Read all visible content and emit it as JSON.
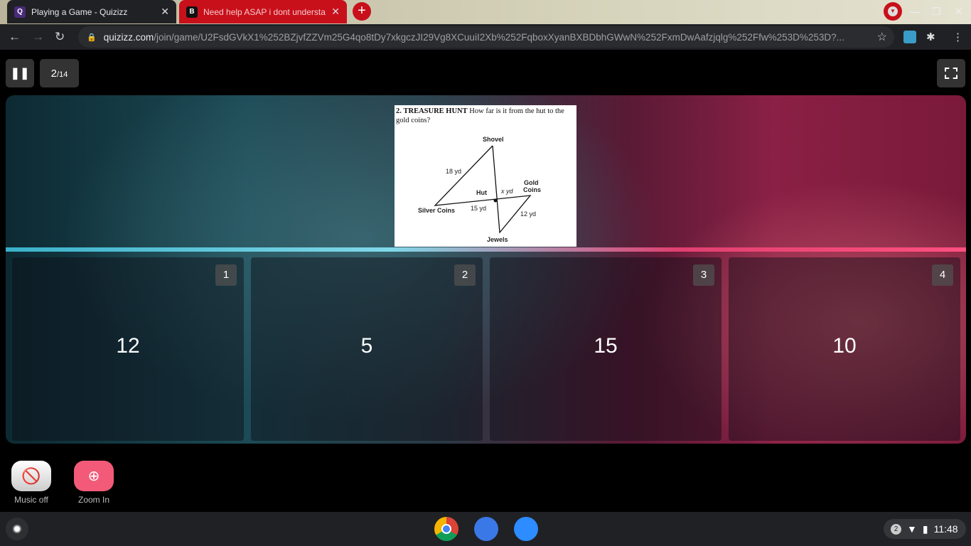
{
  "browser": {
    "tabs": [
      {
        "title": "Playing a Game - Quizizz",
        "favicon": "Q"
      },
      {
        "title": "Need help ASAP i dont understa",
        "favicon": "B"
      }
    ],
    "url_host": "quizizz.com",
    "url_path": "/join/game/U2FsdGVkX1%252BZjvfZZVm25G4qo8tDy7xkgczJI29Vg8XCuuiI2Xb%252FqboxXyanBXBDbhGWwN%252FxmDwAafzjqlg%252Ffw%253D%253D?..."
  },
  "game": {
    "progress_current": "2",
    "progress_total": "/14",
    "question": {
      "number": "2.",
      "heading": "TREASURE HUNT",
      "text": " How far is it from the hut to the gold coins?",
      "diagram_labels": {
        "shovel": "Shovel",
        "silver": "Silver Coins",
        "hut": "Hut",
        "gold1": "Gold",
        "gold2": "Coins",
        "jewels": "Jewels",
        "s18": "18 yd",
        "s15": "15 yd",
        "sx": "x yd",
        "s12": "12 yd"
      }
    },
    "answers": [
      {
        "index": "1",
        "value": "12"
      },
      {
        "index": "2",
        "value": "5"
      },
      {
        "index": "3",
        "value": "15"
      },
      {
        "index": "4",
        "value": "10"
      }
    ],
    "music_label": "Music off",
    "zoom_label": "Zoom In"
  },
  "shelf": {
    "notifications": "2",
    "time": "11:48"
  },
  "colors": {
    "accent": "#f25a78",
    "tab_red": "#c8101b"
  }
}
